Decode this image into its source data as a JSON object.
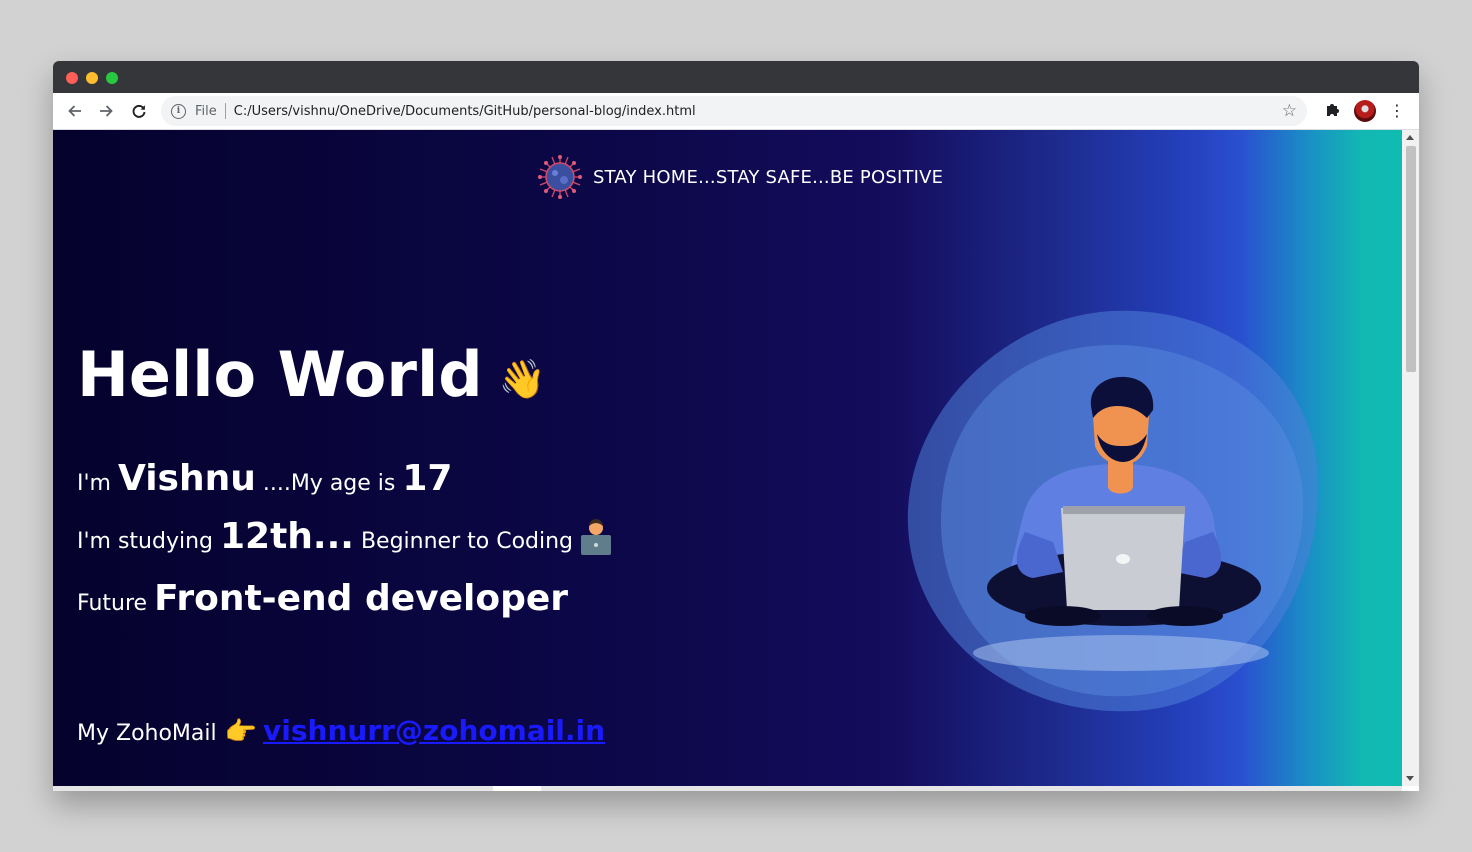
{
  "browser": {
    "url_scheme": "File",
    "url": "C:/Users/vishnu/OneDrive/Documents/GitHub/personal-blog/index.html",
    "icons": [
      "back-icon",
      "forward-icon",
      "reload-icon",
      "info-icon",
      "star-icon",
      "puzzle-icon",
      "avatar",
      "kebab-menu-icon"
    ]
  },
  "page": {
    "banner": "STAY HOME...STAY SAFE...BE POSITIVE",
    "greeting": "Hello World",
    "greeting_emoji": "👋",
    "line1": {
      "a": "I'm ",
      "name": "Vishnu",
      "b": " ....My age is ",
      "age": "17"
    },
    "line2": {
      "a": "I'm studying ",
      "grade": "12th...",
      "b": " Beginner to Coding"
    },
    "line3": {
      "a": "Future ",
      "role": "Front-end developer"
    },
    "mail": {
      "label": "My ZohoMail",
      "pointer": "👉",
      "email": "vishnurr@zohomail.in"
    }
  },
  "colors": {
    "bg_start": "#05022d",
    "bg_mid": "#140c5c",
    "bg_blue": "#2a4fd0",
    "bg_teal": "#10bcb0",
    "link": "#1a1aff"
  }
}
